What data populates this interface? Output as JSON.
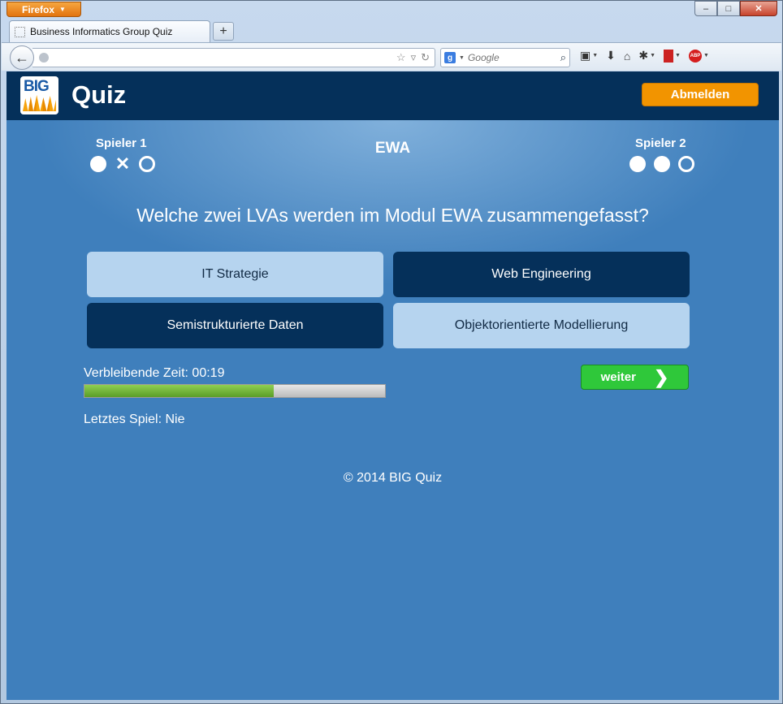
{
  "browser": {
    "menu_label": "Firefox",
    "tab_title": "Business Informatics Group Quiz",
    "new_tab_symbol": "+",
    "url": "",
    "search_engine_letter": "g",
    "search_placeholder": "Google",
    "window_controls": {
      "minimize": "–",
      "maximize": "□",
      "close": "✕"
    },
    "icons": [
      "back-arrow-icon",
      "globe-icon",
      "bookmark-star-icon",
      "dropmarker-icon",
      "reload-icon",
      "search-engine-icon",
      "magnifier-icon",
      "bookmarks-menu-icon",
      "download-icon",
      "home-icon",
      "addon-bug-icon",
      "flag-addon-icon",
      "adblock-plus-icon"
    ],
    "abp_text": "ABP"
  },
  "app": {
    "logo_text": "BIG",
    "title": "Quiz",
    "logout_label": "Abmelden",
    "accent_color": "#f29400",
    "header_color": "#05305a",
    "page_color": "#3f7fbc"
  },
  "game": {
    "player1": {
      "name": "Spieler 1",
      "results": [
        "correct",
        "wrong",
        "open"
      ]
    },
    "player2": {
      "name": "Spieler 2",
      "results": [
        "correct",
        "correct",
        "open"
      ]
    },
    "category": "EWA",
    "question": "Welche zwei LVAs werden im Modul EWA zusammengefasst?",
    "answers": [
      {
        "label": "IT Strategie",
        "selected": false
      },
      {
        "label": "Web Engineering",
        "selected": true
      },
      {
        "label": "Semistrukturierte Daten",
        "selected": true
      },
      {
        "label": "Objektorientierte Modellierung",
        "selected": false
      }
    ],
    "time_label": "Verbleibende Zeit: 00:19",
    "time_progress_fraction": 0.63,
    "next_label": "weiter",
    "last_game_label": "Letztes Spiel: Nie",
    "footer": "© 2014 BIG Quiz"
  }
}
